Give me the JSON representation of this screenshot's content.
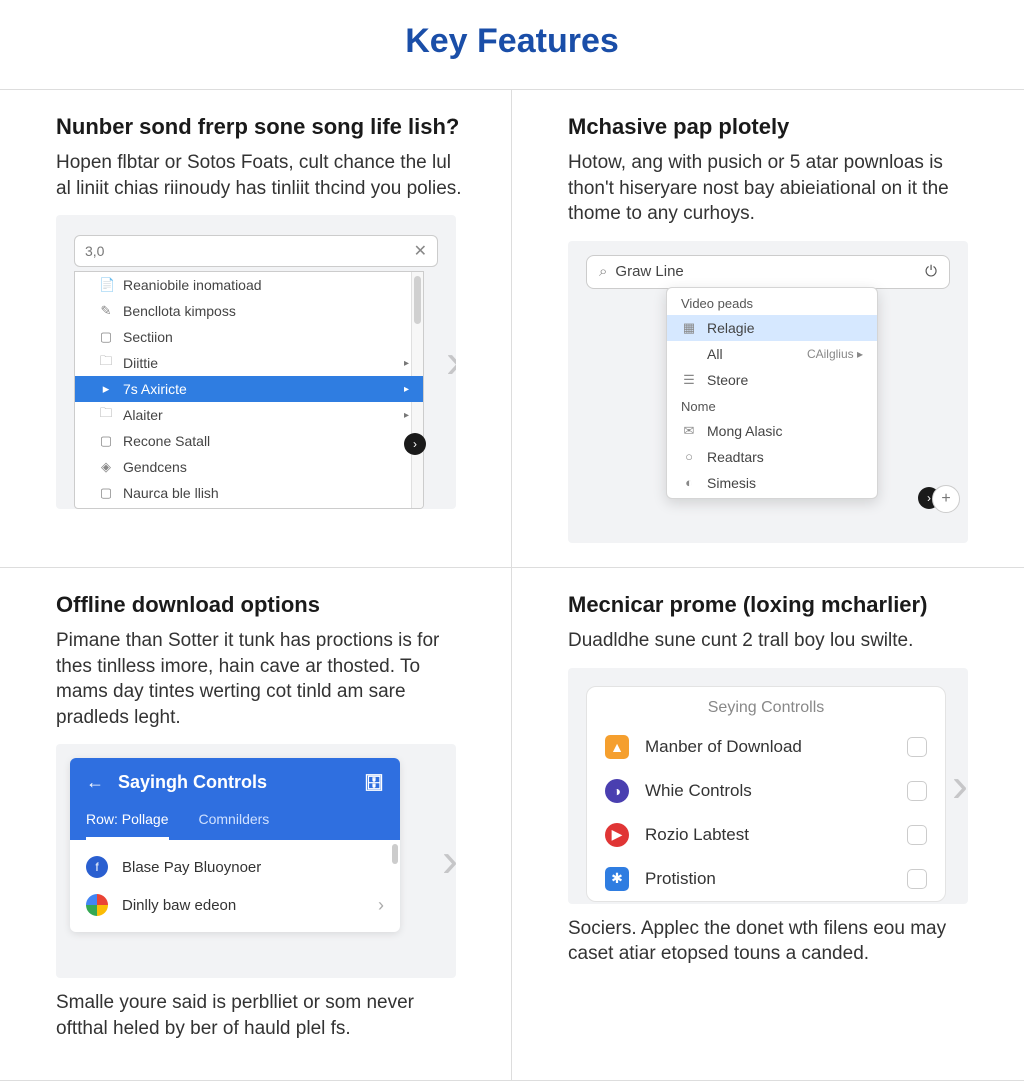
{
  "page_title": "Key Features",
  "features": [
    {
      "title": "Nunber sond frerp sone song life lish?",
      "desc": "Hopen flbtar or Sotos Foats, cult chance the lul al liniit chias riinoudy has tinliit thcind you polies.",
      "search_text": "3,0",
      "items": [
        {
          "icon": "📄",
          "label": "Reaniobile inomatioad"
        },
        {
          "icon": "✎",
          "label": "Bencllota kimposs"
        },
        {
          "icon": "▢",
          "label": "Sectiion"
        },
        {
          "icon": "🗀",
          "label": "Diittie",
          "arrow": true
        },
        {
          "icon": "▸",
          "label": "7s Axiricte",
          "selected": true,
          "arrow": true
        },
        {
          "icon": "🗀",
          "label": "Alaiter",
          "arrow": true
        },
        {
          "icon": "▢",
          "label": "Recone Satall"
        },
        {
          "icon": "◈",
          "label": "Gendcens"
        },
        {
          "icon": "▢",
          "label": "Naurca ble llish"
        }
      ]
    },
    {
      "title": "Mchasive pap plotely",
      "desc": "Hotow, ang with pusich or 5 atar pownloas is thon't hiseryare nost bay abieiational on it the thome to any curhoys.",
      "search_text": "Graw Line",
      "section1": "Video peads",
      "section2": "Nome",
      "items1": [
        {
          "icon": "▦",
          "label": "Relagie",
          "hi": true
        },
        {
          "icon": "",
          "label": "All",
          "sub": "CAilglius ▸"
        },
        {
          "icon": "☰",
          "label": "Steore"
        }
      ],
      "items2": [
        {
          "icon": "✉",
          "label": "Mong Alasic"
        },
        {
          "icon": "○",
          "label": "Readtars"
        },
        {
          "icon": "◐",
          "label": "Simesis"
        }
      ]
    },
    {
      "title": "Offline download options",
      "desc": "Pimane than Sotter it tunk has proctions is for thes tinlless imore, hain cave ar thosted. To mams day tintes werting cot tinld am sare pradleds leght.",
      "caption": "Smalle youre said is perblliet or som never oftthal heled by ber of hauld plel fs.",
      "card_title": "Sayingh Controls",
      "tab1": "Row: Pollage",
      "tab2": "Comnilders",
      "rows": [
        {
          "color": "#2a5fd0",
          "icon": "f",
          "label": "Blase Pay Bluoynoer"
        },
        {
          "color": "#f2b90f",
          "icon": "",
          "label": "Dinlly baw edeon",
          "chrome": true
        }
      ]
    },
    {
      "title": "Mecnicar prome (loxing mcharlier)",
      "desc": "Duadldhe sune cunt 2 trall boy lou swilte.",
      "caption": "Sociers. Applec the donet wth filens eou may caset atiar etopsed touns a canded.",
      "card_title": "Seying Controlls",
      "rows": [
        {
          "color": "#f59f2e",
          "icon": "▲",
          "label": "Manber of Download"
        },
        {
          "color": "#4a3fb0",
          "icon": "◑",
          "label": "Whie Controls"
        },
        {
          "color": "#e03535",
          "icon": "▶",
          "label": "Rozio Labtest"
        },
        {
          "color": "#2f7de1",
          "icon": "✱",
          "label": "Protistion"
        }
      ]
    }
  ]
}
